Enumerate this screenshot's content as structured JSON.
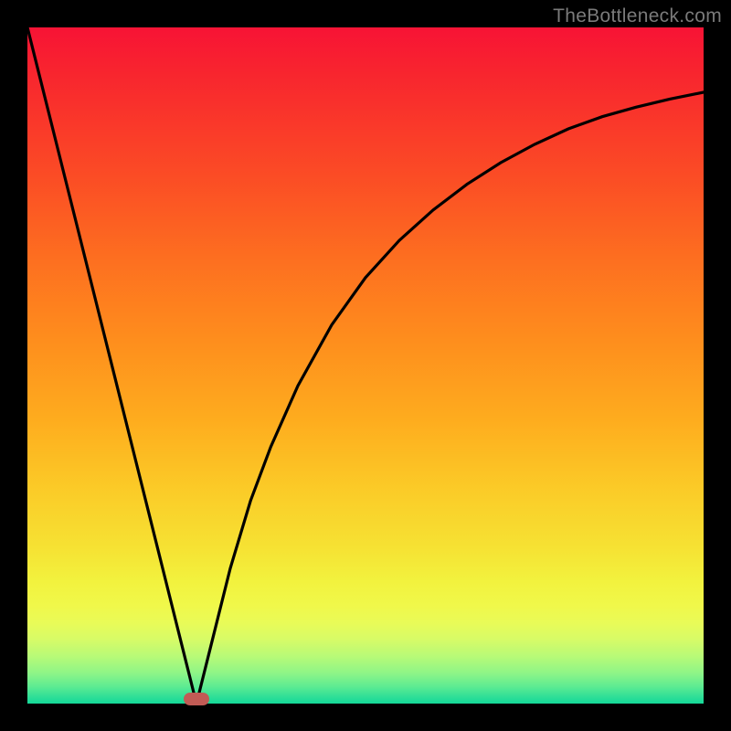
{
  "watermark": "TheBottleneck.com",
  "chart_data": {
    "type": "line",
    "title": "",
    "xlabel": "",
    "ylabel": "",
    "xlim": [
      0,
      100
    ],
    "ylim": [
      0,
      100
    ],
    "grid": false,
    "legend": false,
    "series": [
      {
        "name": "bottleneck-curve",
        "x": [
          0,
          3,
          6,
          9,
          12,
          15,
          18,
          21,
          23,
          25,
          27,
          30,
          33,
          36,
          40,
          45,
          50,
          55,
          60,
          65,
          70,
          75,
          80,
          85,
          90,
          95,
          100
        ],
        "values": [
          100,
          88,
          76,
          64,
          52,
          40,
          28,
          16,
          8,
          0,
          8,
          20,
          30,
          38,
          47,
          56,
          63,
          68.5,
          73,
          76.8,
          80,
          82.7,
          85,
          86.8,
          88.2,
          89.4,
          90.4
        ]
      }
    ],
    "minimum_point": {
      "x": 25,
      "y": 0
    },
    "curve_color": "#000000",
    "marker_color": "#c15b55"
  }
}
